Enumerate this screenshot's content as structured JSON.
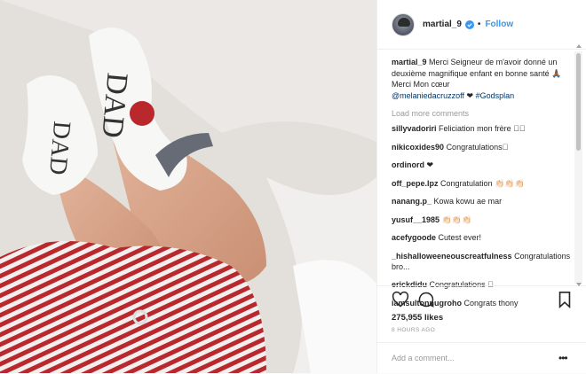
{
  "post": {
    "username": "martial_9",
    "follow_label": "Follow",
    "dot": "•",
    "caption_user": "martial_9",
    "caption_text": "Merci Seigneur de m'avoir donné un deuxième magnifique enfant en bonne santé 🙏🏾 Merci Mon cœur",
    "caption_mention": "@melaniedacruzzoff",
    "caption_heart": " ❤ ",
    "caption_hashtag": "#Godsplan",
    "load_more_label": "Load more comments",
    "likes": "275,955 likes",
    "time": "8 HOURS AGO",
    "add_comment_placeholder": "Add a comment...",
    "more_options": "•••"
  },
  "comments": [
    {
      "user": "sillyvadoriri",
      "text": "Feliciation mon frère ❤🏻"
    },
    {
      "user": "nikicoxides90",
      "text": "Congratulations🏻"
    },
    {
      "user": "ordinord",
      "text": "❤"
    },
    {
      "user": "off_pepe.lpz",
      "text": "Congratulation 👏🏻👏🏻👏🏻"
    },
    {
      "user": "nanang.p_",
      "text": "Kowa kowu ae mar"
    },
    {
      "user": "yusuf__1985",
      "text": "👏🏻👏🏻👏🏻"
    },
    {
      "user": "acefygoode",
      "text": "Cutest ever!"
    },
    {
      "user": "_hishalloweeneouscreatfulness",
      "text": "Congratulations bro..."
    },
    {
      "user": "erickdidu",
      "text": "Congratulations 🏻"
    },
    {
      "user": "iamsultonnugroho",
      "text": "Congrats thony"
    }
  ],
  "icons": {
    "verified": "verified-badge-icon",
    "heart": "heart-icon",
    "comment": "comment-icon",
    "bookmark": "bookmark-icon"
  },
  "colors": {
    "link": "#3897f0",
    "tag": "#003569",
    "muted": "#999999",
    "text": "#262626"
  }
}
